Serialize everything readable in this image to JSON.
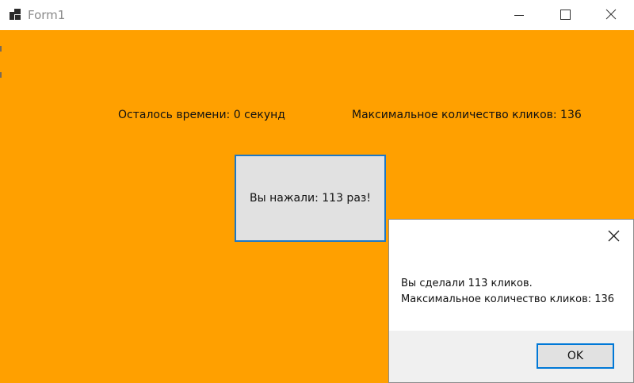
{
  "window": {
    "title": "Form1",
    "icons": {
      "app": "app-icon",
      "minimize": "minimize-icon",
      "maximize": "maximize-icon",
      "close": "close-icon"
    }
  },
  "form": {
    "time_left_label": "Осталось времени: 0 секунд",
    "max_clicks_label": "Максимальное количество кликов: 136",
    "click_button_label": "Вы нажали: 113 раз!",
    "background_color": "#ffa000"
  },
  "message_box": {
    "line1": "Вы сделали 113 кликов.",
    "line2": "Максимальное количество кликов: 136",
    "ok_label": "OK",
    "close_icon": "close-icon"
  },
  "colors": {
    "accent_border": "#0078d7",
    "button_face": "#e1e1e1",
    "dialog_footer": "#f0f0f0"
  }
}
